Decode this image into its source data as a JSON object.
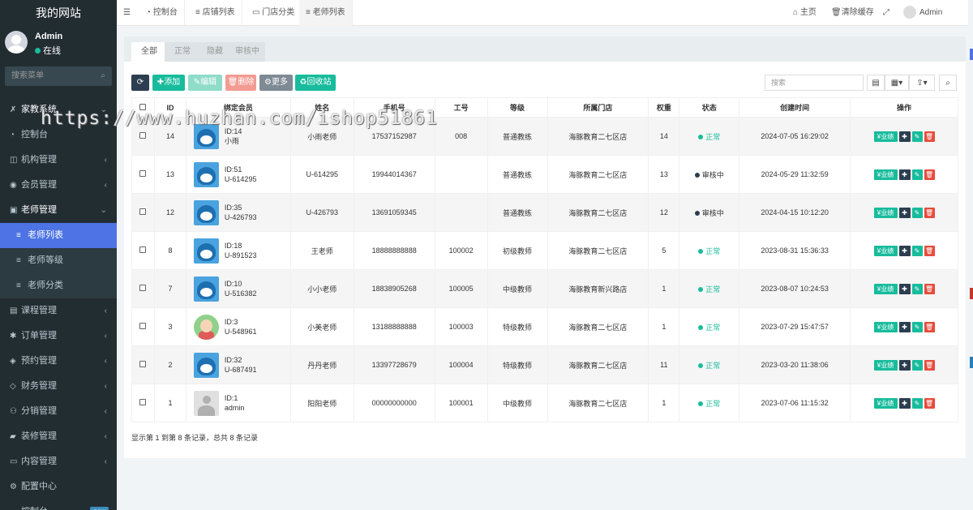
{
  "app": {
    "title": "我的网站"
  },
  "user": {
    "name": "Admin",
    "status": "在线"
  },
  "side_search": {
    "placeholder": "搜索菜单"
  },
  "sidebar": {
    "items": [
      {
        "label": "家教系统",
        "icon": "wrench-icon",
        "type": "header"
      },
      {
        "label": "控制台",
        "icon": "dashboard-icon"
      },
      {
        "label": "机构管理",
        "icon": "columns-icon"
      },
      {
        "label": "会员管理",
        "icon": "user-circle-icon"
      },
      {
        "label": "老师管理",
        "icon": "vimeo-icon",
        "type": "open"
      },
      {
        "label": "老师列表",
        "icon": "list-icon",
        "type": "active"
      },
      {
        "label": "老师等级",
        "icon": "list-icon",
        "type": "sub"
      },
      {
        "label": "老师分类",
        "icon": "list-icon",
        "type": "sub"
      },
      {
        "label": "课程管理",
        "icon": "book-icon"
      },
      {
        "label": "订单管理",
        "icon": "cog-icon"
      },
      {
        "label": "预约管理",
        "icon": "money-icon"
      },
      {
        "label": "财务管理",
        "icon": "diamond-icon"
      },
      {
        "label": "分销管理",
        "icon": "users-icon"
      },
      {
        "label": "装修管理",
        "icon": "car-icon"
      },
      {
        "label": "内容管理",
        "icon": "file-icon"
      },
      {
        "label": "配置中心",
        "icon": "gear-icon"
      },
      {
        "label": "控制台",
        "icon": "dashboard-icon",
        "badge": "new"
      }
    ]
  },
  "topbar": {
    "tabs": [
      {
        "label": "控制台",
        "icon": "dashboard-icon"
      },
      {
        "label": "店铺列表",
        "icon": "list-icon"
      },
      {
        "label": "门店分类",
        "icon": "folder-icon"
      },
      {
        "label": "老师列表",
        "icon": "list-icon",
        "active": true
      }
    ],
    "home": "主页",
    "clear_cache": "清除缓存",
    "user": "Admin"
  },
  "panel_tabs": [
    "全部",
    "正常",
    "隐藏",
    "审核中"
  ],
  "toolbar": {
    "add": "添加",
    "edit": "编辑",
    "delete": "删除",
    "more": "更多",
    "recycle": "回收站",
    "search_placeholder": "搜索"
  },
  "table": {
    "headers": [
      "ID",
      "绑定会员",
      "姓名",
      "手机号",
      "工号",
      "等级",
      "所属门店",
      "权重",
      "状态",
      "创建时间",
      "操作"
    ],
    "rows": [
      {
        "id": "14",
        "member_id": "ID:14",
        "member_name": "小雨",
        "avatar": "face",
        "name": "小雨老师",
        "phone": "17537152987",
        "no": "008",
        "level": "普通教练",
        "store": "海豚教育二七区店",
        "weight": "14",
        "status": "正常",
        "status_type": "ok",
        "created": "2024-07-05 16:29:02"
      },
      {
        "id": "13",
        "member_id": "ID:51",
        "member_name": "U-614295",
        "avatar": "face",
        "name": "U-614295",
        "phone": "19944014367",
        "no": "",
        "level": "普通教练",
        "store": "海豚教育二七区店",
        "weight": "13",
        "status": "审核中",
        "status_type": "pend",
        "created": "2024-05-29 11:32:59"
      },
      {
        "id": "12",
        "member_id": "ID:35",
        "member_name": "U-426793",
        "avatar": "face",
        "name": "U-426793",
        "phone": "13691059345",
        "no": "",
        "level": "普通教练",
        "store": "海豚教育二七区店",
        "weight": "12",
        "status": "审核中",
        "status_type": "pend",
        "created": "2024-04-15 10:12:20"
      },
      {
        "id": "8",
        "member_id": "ID:18",
        "member_name": "U-891523",
        "avatar": "face",
        "name": "王老师",
        "phone": "18888888888",
        "no": "100002",
        "level": "初级教师",
        "store": "海豚教育二七区店",
        "weight": "5",
        "status": "正常",
        "status_type": "ok",
        "created": "2023-08-31 15:36:33"
      },
      {
        "id": "7",
        "member_id": "ID:10",
        "member_name": "U-516382",
        "avatar": "face",
        "name": "小小老师",
        "phone": "18838905268",
        "no": "100005",
        "level": "中级教师",
        "store": "海豚教育新兴路店",
        "weight": "1",
        "status": "正常",
        "status_type": "ok",
        "created": "2023-08-07 10:24:53"
      },
      {
        "id": "3",
        "member_id": "ID:3",
        "member_name": "U-548961",
        "avatar": "girl",
        "name": "小美老师",
        "phone": "13188888888",
        "no": "100003",
        "level": "特级教师",
        "store": "海豚教育二七区店",
        "weight": "1",
        "status": "正常",
        "status_type": "ok",
        "created": "2023-07-29 15:47:57"
      },
      {
        "id": "2",
        "member_id": "ID:32",
        "member_name": "U-687491",
        "avatar": "face",
        "name": "丹丹老师",
        "phone": "13397728679",
        "no": "100004",
        "level": "特级教师",
        "store": "海豚教育二七区店",
        "weight": "11",
        "status": "正常",
        "status_type": "ok",
        "created": "2023-03-20 11:38:06"
      },
      {
        "id": "1",
        "member_id": "ID:1",
        "member_name": "admin",
        "avatar": "def",
        "name": "阳阳老师",
        "phone": "00000000000",
        "no": "100001",
        "level": "中级教师",
        "store": "海豚教育二七区店",
        "weight": "1",
        "status": "正常",
        "status_type": "ok",
        "created": "2023-07-06 11:15:32"
      }
    ],
    "op_label": "¥业绩"
  },
  "pagination": {
    "summary": "显示第 1 到第 8 条记录，总共 8 条记录"
  },
  "watermark": "https://www.huzhan.com/ishop51861",
  "colors": {
    "sidebar": "#222d32",
    "active": "#4d73e4",
    "success": "#18bc9c",
    "danger": "#e74c3c",
    "dark": "#2c3e50"
  }
}
